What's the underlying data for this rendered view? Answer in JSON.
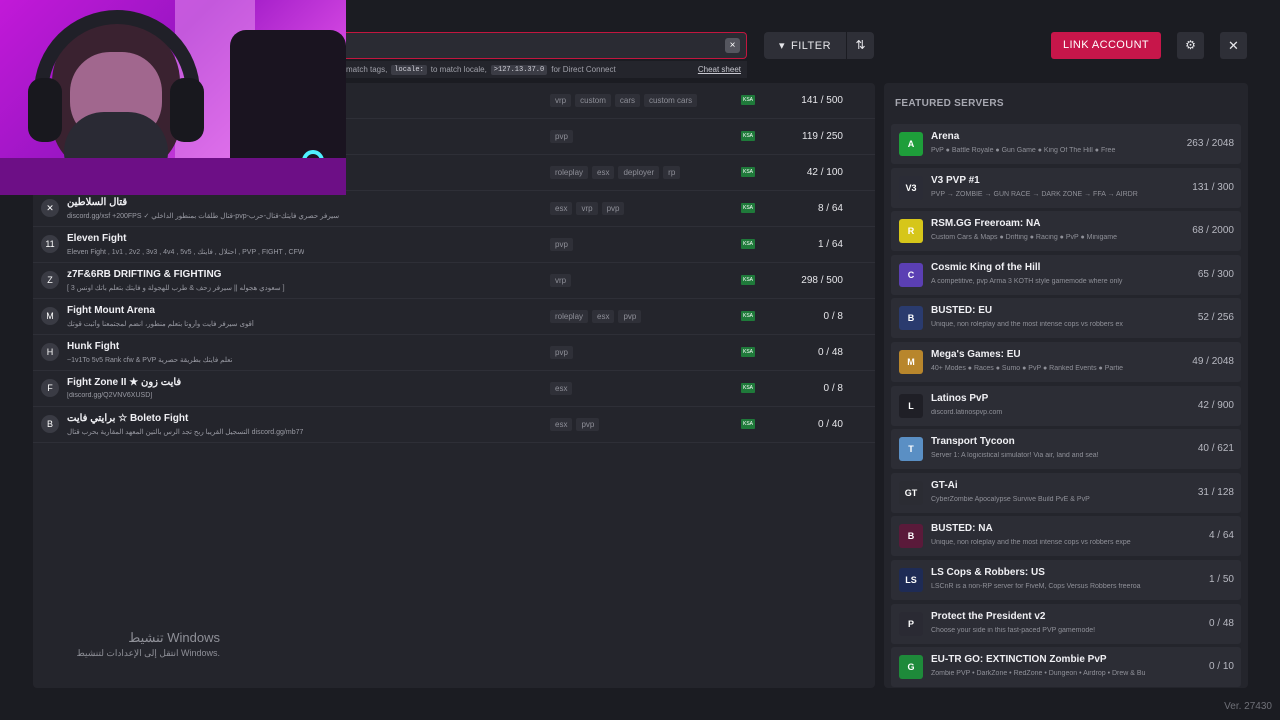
{
  "search": {
    "hint_prefix": "match tags,",
    "locale_code": "locale:",
    "hint_mid": "to match locale,",
    "ip_code": ">127.13.37.0",
    "hint_suffix": "for Direct Connect",
    "cheat_sheet": "Cheat sheet",
    "clear": "×"
  },
  "toolbar": {
    "filter_label": "FILTER",
    "filter_icon": "▾",
    "sort_icon": "⇅",
    "link_account": "LINK ACCOUNT",
    "settings_icon": "⚙",
    "close_icon": "✕"
  },
  "servers": [
    {
      "name": "",
      "desc": "",
      "icon": "",
      "tags": [
        "vrp",
        "custom",
        "cars",
        "custom cars"
      ],
      "players": "141 / 500"
    },
    {
      "name": "",
      "desc": "",
      "icon": "",
      "tags": [
        "pvp"
      ],
      "players": "119 / 250"
    },
    {
      "name": "",
      "desc": "",
      "icon": "",
      "tags": [
        "roleplay",
        "esx",
        "deployer",
        "rp"
      ],
      "players": "42 / 100"
    },
    {
      "name": "قتال السلاطين",
      "desc": "discord.gg/xsf +200FPS ✓ قتال طلقات بمنطور الداخلي-pvp-سيرفر حصري فايتك-قتال-حرب",
      "icon": "✕",
      "tags": [
        "esx",
        "vrp",
        "pvp"
      ],
      "players": "8 / 64"
    },
    {
      "name": "Eleven Fight",
      "desc": "Eleven Fight , 1v1 , 2v2 , 3v3 , 4v4 , 5v5 , احتلال , فايتك , PVP , FIGHT , CFW",
      "icon": "11",
      "tags": [
        "pvp"
      ],
      "players": "1 / 64"
    },
    {
      "name": "z7F&6RB DRIFTING & FIGHTING",
      "desc": "[ سعودي هجوله || سيرفر زحف & طرب للهجولة و فايتك بتعلم باتك اونس 3 ]",
      "icon": "Z",
      "tags": [
        "vrp"
      ],
      "players": "298 / 500"
    },
    {
      "name": "Fight Mount Arena",
      "desc": "أقوى سيرفر فايت وأروتا بتعلم منطور، انضم لمجتمعنا وأثبت قوتك",
      "icon": "M",
      "tags": [
        "roleplay",
        "esx",
        "pvp"
      ],
      "players": "0 / 8"
    },
    {
      "name": "Hunk Fight",
      "desc": "~1v1To 5v5 Rank cfw & PVP تعلم فايتك بطريقة حصرية",
      "icon": "H",
      "tags": [
        "pvp"
      ],
      "players": "0 / 48"
    },
    {
      "name": "Fight Zone II ★ فايت زون",
      "desc": "[discord.gg/Q2VNV6XUSD]",
      "icon": "F",
      "tags": [
        "esx"
      ],
      "players": "0 / 8"
    },
    {
      "name": "برايتي فايت ☆ Boleto Fight",
      "desc": "التسجيل القريبا ربح تجد الرس بالتين المعهد المقارية بحرب قتال discord.gg/mb77",
      "icon": "B",
      "tags": [
        "esx",
        "pvp"
      ],
      "players": "0 / 40"
    }
  ],
  "flag_label": "KSA",
  "activate": {
    "line1": "تنشيط Windows",
    "line2": "انتقل إلى الإعدادات لتنشيط Windows."
  },
  "featured": {
    "title": "FEATURED SERVERS",
    "items": [
      {
        "name": "Arena",
        "desc": "PvP ● Battle Royale ● Gun Game ● King Of The Hill ● Free",
        "players": "263 / 2048",
        "icon": "A",
        "color": "#1e9e3a"
      },
      {
        "name": "V3 PVP #1",
        "desc": "PVP → ZOMBIE → GUN RACE → DARK ZONE → FFA → AIRDR",
        "players": "131 / 300",
        "icon": "V3",
        "color": "#2b2c36"
      },
      {
        "name": "RSM.GG Freeroam: NA",
        "desc": "Custom Cars & Maps ● Drifting ● Racing ● PvP ● Minigame",
        "players": "68 / 2000",
        "icon": "R",
        "color": "#d6c61a"
      },
      {
        "name": "Cosmic King of the Hill",
        "desc": "A competitive, pvp Arma 3 KOTH style gamemode where only",
        "players": "65 / 300",
        "icon": "C",
        "color": "#5b3fb3"
      },
      {
        "name": "BUSTED: EU",
        "desc": "Unique, non roleplay and the most intense cops vs robbers ex",
        "players": "52 / 256",
        "icon": "B",
        "color": "#2a3b6e"
      },
      {
        "name": "Mega's Games: EU",
        "desc": "40+ Modes ● Races ● Sumo ● PvP ● Ranked Events ● Partie",
        "players": "49 / 2048",
        "icon": "M",
        "color": "#b8862c"
      },
      {
        "name": "Latinos PvP",
        "desc": "discord.latinospvp.com",
        "players": "42 / 900",
        "icon": "L",
        "color": "#1f1f26"
      },
      {
        "name": "Transport Tycoon",
        "desc": "Server 1: A logicistical simulator! Via air, land and sea!",
        "players": "40 / 621",
        "icon": "T",
        "color": "#5a8fc4"
      },
      {
        "name": "GT-Ai",
        "desc": "CyberZombie Apocalypse Survive Build PvE & PvP",
        "players": "31 / 128",
        "icon": "GT",
        "color": "#2b2c33"
      },
      {
        "name": "BUSTED: NA",
        "desc": "Unique, non roleplay and the most intense cops vs robbers expe",
        "players": "4 / 64",
        "icon": "B",
        "color": "#5a1a3a"
      },
      {
        "name": "LS Cops & Robbers: US",
        "desc": "LSCnR is a non-RP server for FiveM, Cops Versus Robbers freeroa",
        "players": "1 / 50",
        "icon": "LS",
        "color": "#1e2b55"
      },
      {
        "name": "Protect the President v2",
        "desc": "Choose your side in this fast-paced PVP gamemode!",
        "players": "0 / 48",
        "icon": "P",
        "color": "#2a2a33"
      },
      {
        "name": "EU-TR GO: EXTINCTION Zombie PvP",
        "desc": "Zombie PVP • DarkZone • RedZone • Dungeon • Airdrop • Drew & Bu",
        "players": "0 / 10",
        "icon": "G",
        "color": "#1e8a3a"
      }
    ]
  },
  "version": "Ver. 27430"
}
